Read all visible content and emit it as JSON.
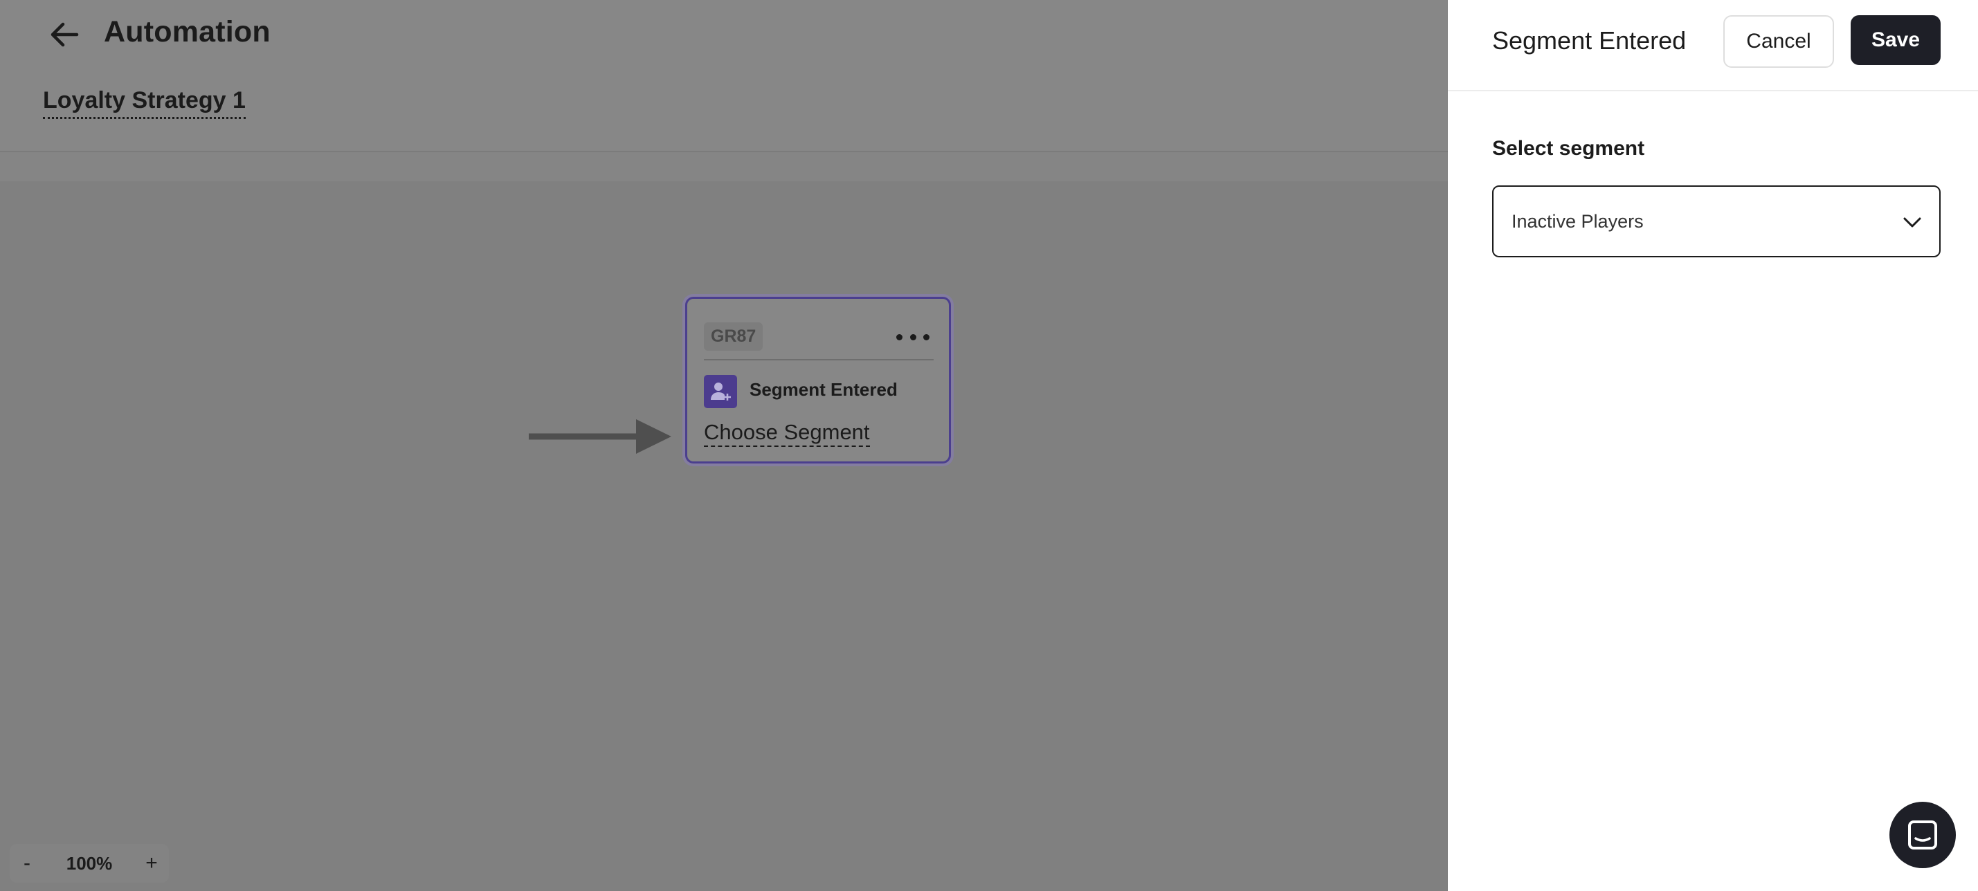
{
  "header": {
    "title": "Automation",
    "strategy_name": "Loyalty Strategy 1"
  },
  "node": {
    "id": "GR87",
    "type_label": "Segment Entered",
    "action_label": "Choose Segment"
  },
  "zoom": {
    "minus": "-",
    "level": "100%",
    "plus": "+"
  },
  "panel": {
    "title": "Segment Entered",
    "cancel_label": "Cancel",
    "save_label": "Save",
    "field_label": "Select segment",
    "selected_segment": "Inactive Players"
  },
  "icons": {
    "back": "arrow-left-icon",
    "menu": "more-horizontal-icon",
    "badge": "user-plus-icon",
    "chevron": "chevron-down-icon",
    "chat": "chat-icon"
  },
  "colors": {
    "overlay": "#808080",
    "accent_purple": "#4c3c8e",
    "primary_dark": "#1e1f27",
    "panel_bg": "#ffffff"
  }
}
